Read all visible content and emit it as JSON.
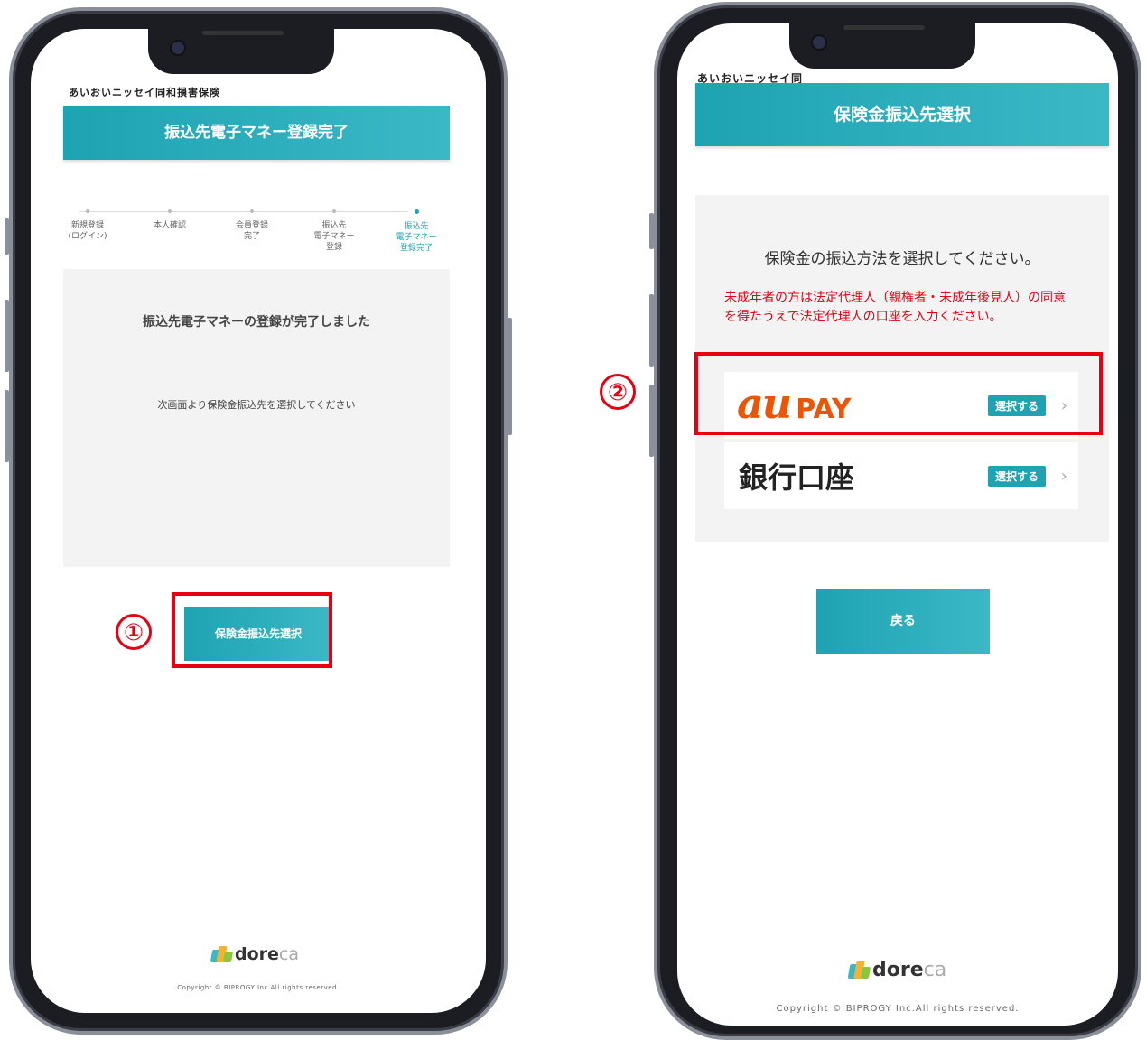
{
  "left": {
    "brand": "あいおいニッセイ同和損害保険",
    "title": "振込先電子マネー登録完了",
    "steps": [
      {
        "label": "新規登録\n(ログイン)"
      },
      {
        "label": "本人確認"
      },
      {
        "label": "会員登録\n完了"
      },
      {
        "label": "振込先\n電子マネー\n登録"
      },
      {
        "label": "振込先\n電子マネー\n登録完了"
      }
    ],
    "message": "振込先電子マネーの登録が完了しました",
    "sub_message": "次画面より保険金振込先を選択してください",
    "button_label": "保険金振込先選択",
    "annotation": "①"
  },
  "right": {
    "brand": "あいおいニッセイ同",
    "title": "保険金振込先選択",
    "prompt": "保険金の振込方法を選択してください。",
    "warning": "未成年者の方は法定代理人（親権者・未成年後見人）の同意を得たうえで法定代理人の口座を入力ください。",
    "options": [
      {
        "logo_main": "au",
        "logo_sub": "PAY",
        "badge": "選択する"
      },
      {
        "label": "銀行口座",
        "badge": "選択する"
      }
    ],
    "back_label": "戻る",
    "annotation": "②"
  },
  "footer": {
    "logo_text_1": "dore",
    "logo_text_2": "ca",
    "copyright": "Copyright © BIPROGY Inc.All rights reserved."
  },
  "colors": {
    "accent": "#1ea3b3",
    "annotation": "#e60012",
    "au_orange": "#eb5505"
  }
}
